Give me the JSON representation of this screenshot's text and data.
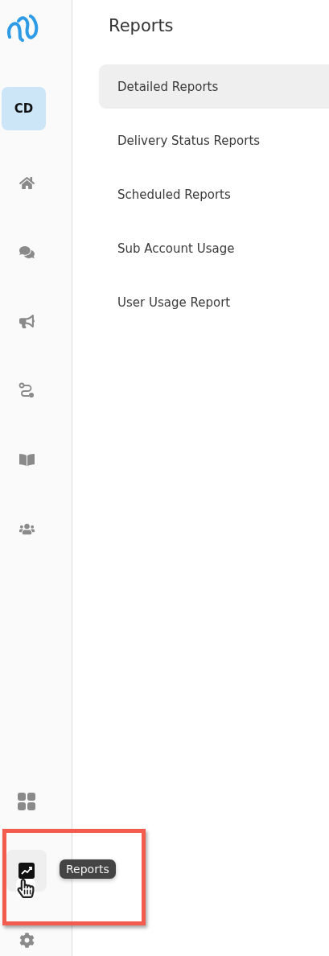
{
  "sidebar": {
    "avatar": "CD",
    "top_items": [
      {
        "kind": "home",
        "selected": false
      },
      {
        "kind": "chat",
        "selected": false
      },
      {
        "kind": "megaphone",
        "selected": false
      },
      {
        "kind": "route",
        "selected": false
      },
      {
        "kind": "book",
        "selected": false
      },
      {
        "kind": "users",
        "selected": false
      }
    ],
    "bottom_items": [
      {
        "kind": "grid",
        "selected": false
      },
      {
        "kind": "chart",
        "selected": true,
        "tooltip": "Reports"
      },
      {
        "kind": "gear",
        "selected": false
      }
    ]
  },
  "panel": {
    "title": "Reports",
    "items": [
      {
        "label": "Detailed Reports",
        "selected": true
      },
      {
        "label": "Delivery Status Reports",
        "selected": false
      },
      {
        "label": "Scheduled Reports",
        "selected": false
      },
      {
        "label": "Sub Account Usage",
        "selected": false
      },
      {
        "label": "User Usage Report",
        "selected": false
      }
    ]
  }
}
